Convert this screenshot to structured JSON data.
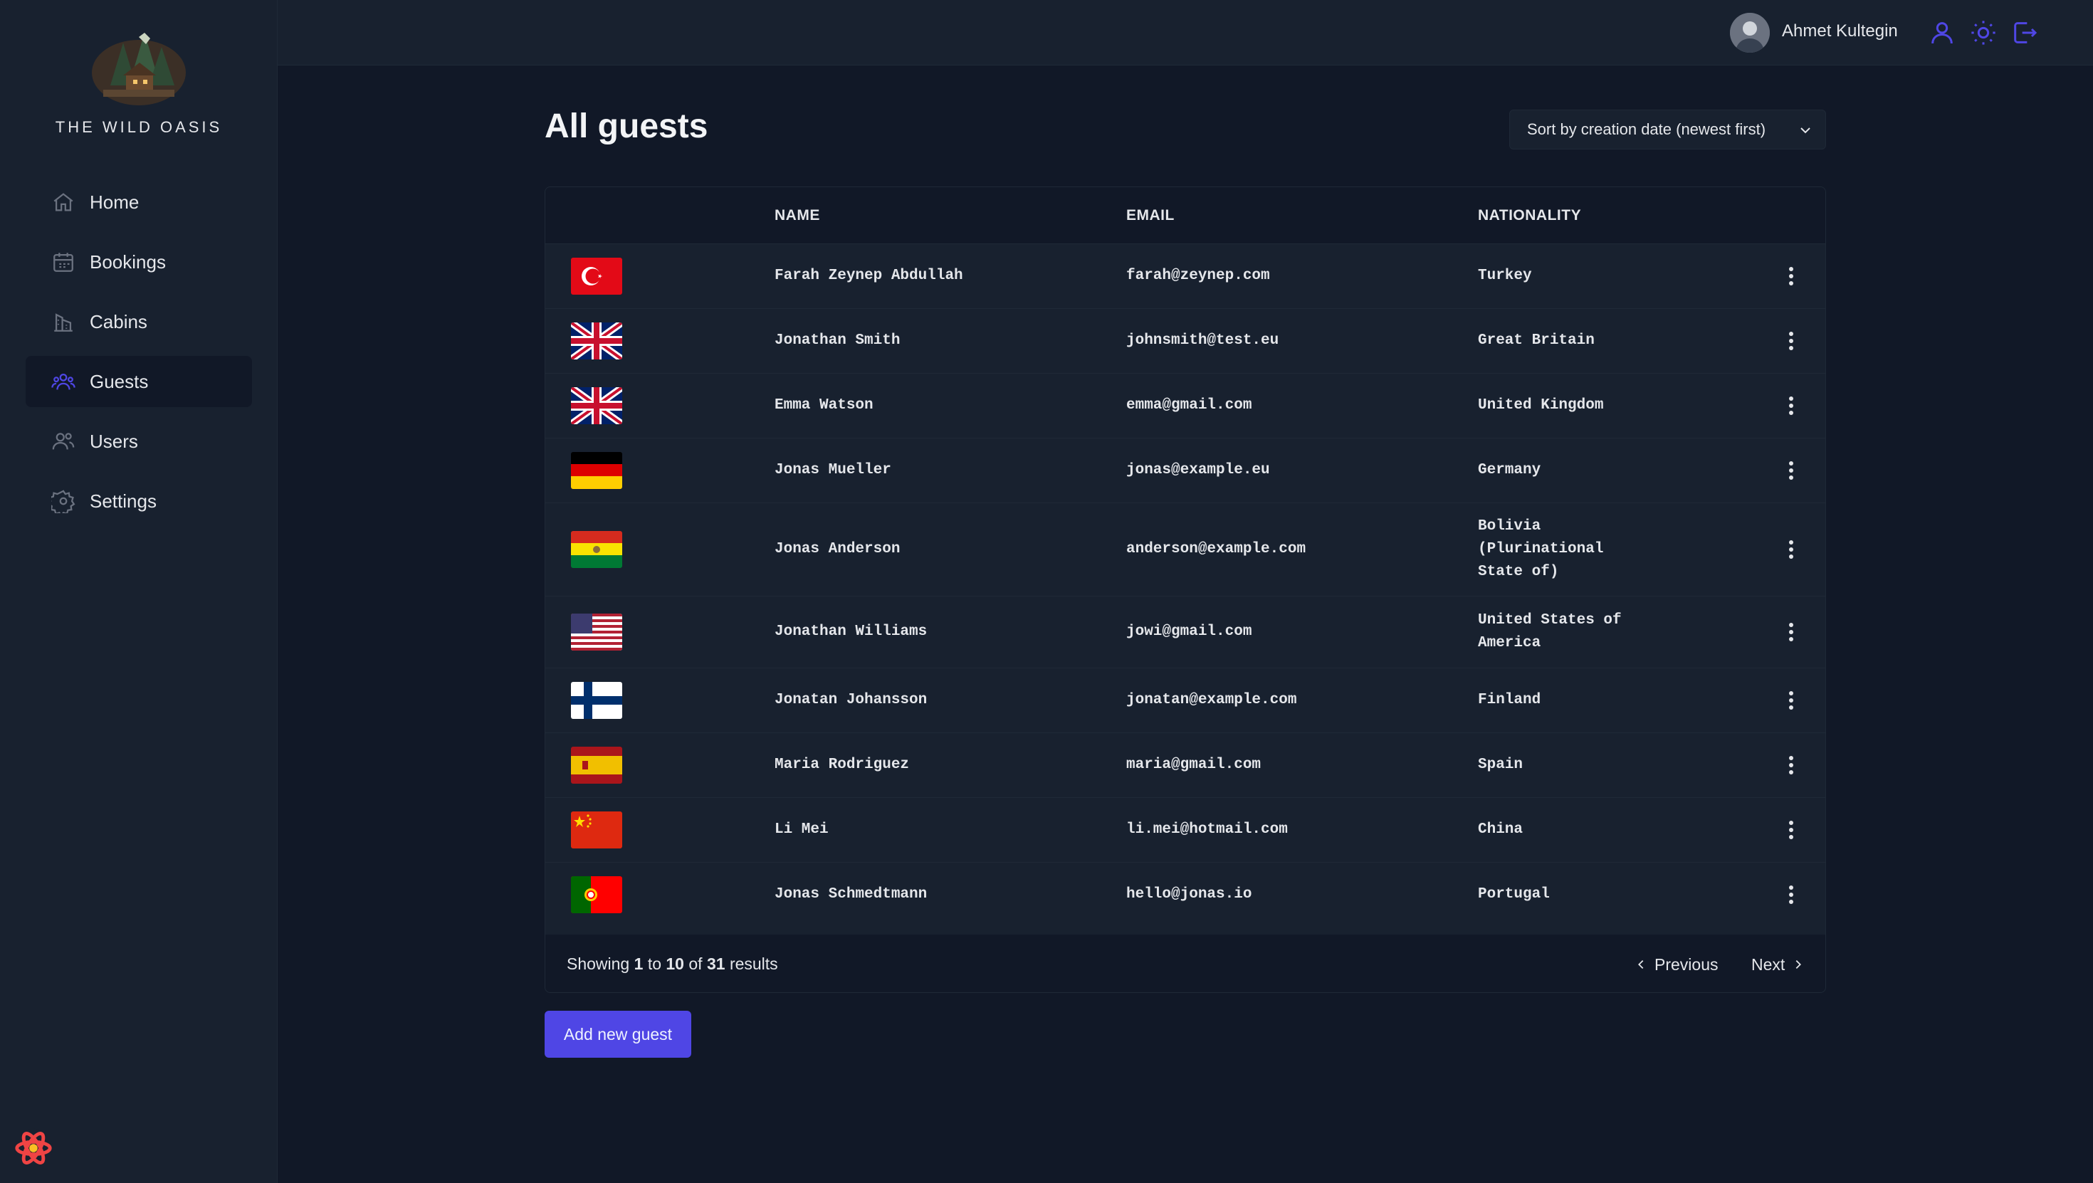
{
  "app": {
    "name": "THE WILD OASIS"
  },
  "sidebar": {
    "items": [
      {
        "label": "Home",
        "icon": "home-icon"
      },
      {
        "label": "Bookings",
        "icon": "calendar-icon"
      },
      {
        "label": "Cabins",
        "icon": "building-icon"
      },
      {
        "label": "Guests",
        "icon": "users-icon",
        "active": true
      },
      {
        "label": "Users",
        "icon": "user-group-icon"
      },
      {
        "label": "Settings",
        "icon": "gear-icon"
      }
    ]
  },
  "header": {
    "user_name": "Ahmet Kultegin",
    "icons": [
      "user-icon",
      "sun-icon",
      "logout-icon"
    ]
  },
  "main": {
    "title": "All guests",
    "sort": {
      "selected": "Sort by creation date (newest first)"
    },
    "table": {
      "columns": [
        "NAME",
        "EMAIL",
        "NATIONALITY"
      ],
      "rows": [
        {
          "name": "Farah Zeynep Abdullah",
          "email": "farah@zeynep.com",
          "nationality": "Turkey",
          "flag": "turkey"
        },
        {
          "name": "Jonathan Smith",
          "email": "johnsmith@test.eu",
          "nationality": "Great Britain",
          "flag": "uk"
        },
        {
          "name": "Emma Watson",
          "email": "emma@gmail.com",
          "nationality": "United Kingdom",
          "flag": "uk"
        },
        {
          "name": "Jonas Mueller",
          "email": "jonas@example.eu",
          "nationality": "Germany",
          "flag": "germany"
        },
        {
          "name": "Jonas Anderson",
          "email": "anderson@example.com",
          "nationality": "Bolivia (Plurinational State of)",
          "nationality_lines": [
            "Bolivia",
            "(Plurinational",
            "State of)"
          ],
          "flag": "bolivia"
        },
        {
          "name": "Jonathan Williams",
          "email": "jowi@gmail.com",
          "nationality": "United States of America",
          "nationality_lines": [
            "United States of",
            "America"
          ],
          "flag": "usa"
        },
        {
          "name": "Jonatan Johansson",
          "email": "jonatan@example.com",
          "nationality": "Finland",
          "flag": "finland"
        },
        {
          "name": "Maria Rodriguez",
          "email": "maria@gmail.com",
          "nationality": "Spain",
          "flag": "spain"
        },
        {
          "name": "Li Mei",
          "email": "li.mei@hotmail.com",
          "nationality": "China",
          "flag": "china"
        },
        {
          "name": "Jonas Schmedtmann",
          "email": "hello@jonas.io",
          "nationality": "Portugal",
          "flag": "portugal"
        }
      ]
    },
    "pagination": {
      "showing_prefix": "Showing",
      "from": "1",
      "to_word": "to",
      "to": "10",
      "of_word": "of",
      "total": "31",
      "results_word": "results",
      "previous_label": "Previous",
      "next_label": "Next"
    },
    "add_button_label": "Add new guest"
  },
  "colors": {
    "accent": "#4f46e5",
    "background": "#111827",
    "surface": "#18212f"
  }
}
